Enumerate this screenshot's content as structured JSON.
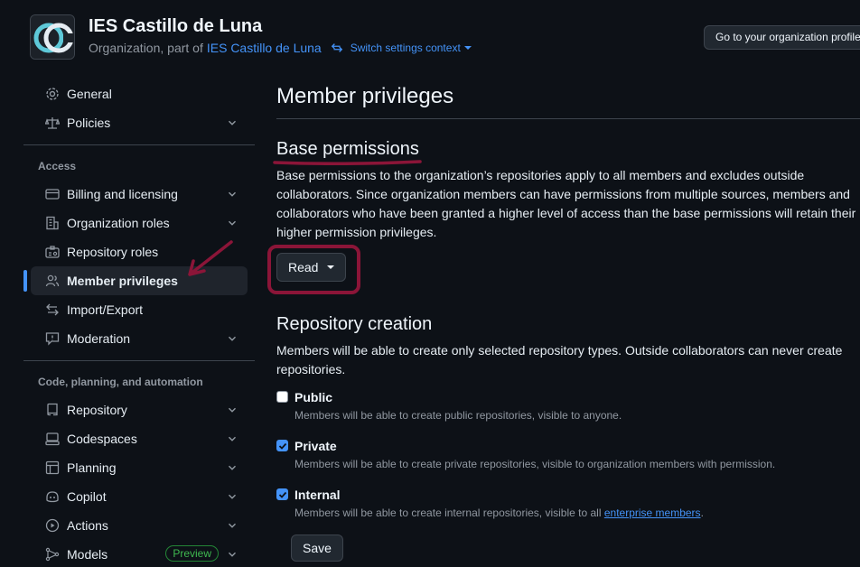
{
  "header": {
    "org_name": "IES Castillo de Luna",
    "subtitle_prefix": "Organization, part of",
    "parent_link": "IES Castillo de Luna",
    "switch_context": "Switch settings context",
    "profile_button": "Go to your organization profile"
  },
  "sidebar": {
    "top_items": [
      {
        "label": "General",
        "icon": "gear-icon"
      },
      {
        "label": "Policies",
        "icon": "law-icon"
      }
    ],
    "access_label": "Access",
    "access_items": [
      {
        "label": "Billing and licensing",
        "icon": "credit-card-icon"
      },
      {
        "label": "Organization roles",
        "icon": "organization-icon"
      },
      {
        "label": "Repository roles",
        "icon": "id-badge-icon"
      },
      {
        "label": "Member privileges",
        "icon": "people-icon",
        "active": true
      },
      {
        "label": "Import/Export",
        "icon": "arrow-switch-icon"
      },
      {
        "label": "Moderation",
        "icon": "report-icon"
      }
    ],
    "code_label": "Code, planning, and automation",
    "code_items": [
      {
        "label": "Repository",
        "icon": "repo-icon"
      },
      {
        "label": "Codespaces",
        "icon": "codespaces-icon"
      },
      {
        "label": "Planning",
        "icon": "table-icon"
      },
      {
        "label": "Copilot",
        "icon": "copilot-icon"
      },
      {
        "label": "Actions",
        "icon": "play-icon"
      },
      {
        "label": "Models",
        "icon": "models-icon",
        "badge": "Preview"
      }
    ]
  },
  "main": {
    "title": "Member privileges",
    "base_permissions": {
      "heading": "Base permissions",
      "description": "Base permissions to the organization’s repositories apply to all members and excludes outside collaborators. Since organization members can have permissions from multiple sources, members and collaborators who have been granted a higher level of access than the base permissions will retain their higher permission privileges.",
      "selected": "Read"
    },
    "repo_creation": {
      "heading": "Repository creation",
      "description": "Members will be able to create only selected repository types. Outside collaborators can never create repositories.",
      "options": [
        {
          "title": "Public",
          "desc": "Members will be able to create public repositories, visible to anyone.",
          "checked": false
        },
        {
          "title": "Private",
          "desc": "Members will be able to create private repositories, visible to organization members with permission.",
          "checked": true
        },
        {
          "title": "Internal",
          "desc_prefix": "Members will be able to create internal repositories, visible to all",
          "desc_link": "enterprise members",
          "desc_suffix": ".",
          "checked": true
        }
      ],
      "save": "Save"
    }
  },
  "colors": {
    "background": "#0d1117",
    "accent": "#4493f8",
    "annotation": "#8b1538",
    "preview_badge": "#3fb950"
  }
}
